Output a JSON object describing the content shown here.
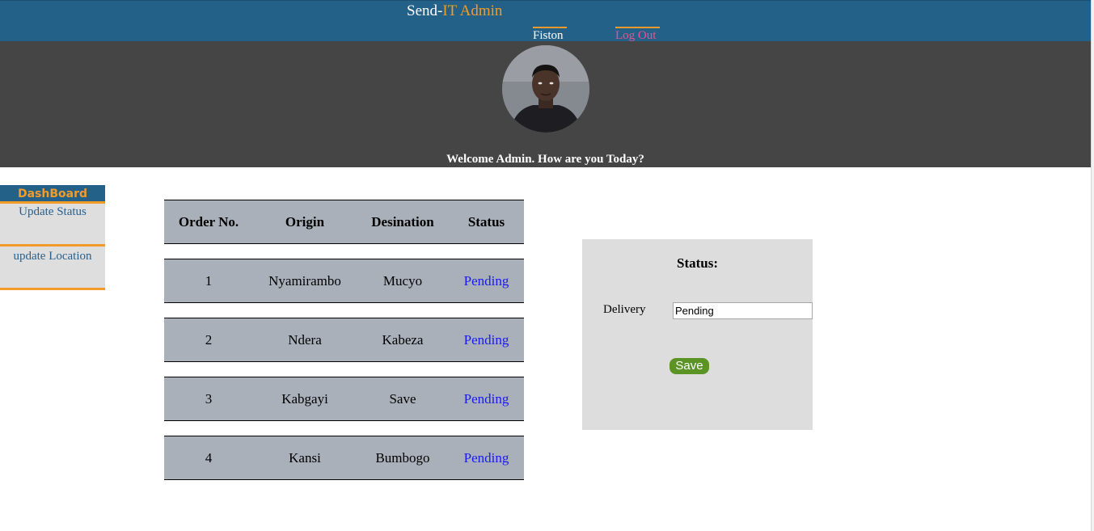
{
  "header": {
    "brand_prefix": "Send-",
    "brand_accent": "IT Admin",
    "user_link": "Fiston",
    "logout_link": "Log Out"
  },
  "hero": {
    "welcome": "Welcome Admin. How are you Today?"
  },
  "sidebar": {
    "title": "DashBoard",
    "items": [
      {
        "label": "Update Status"
      },
      {
        "label": "update Location"
      }
    ]
  },
  "orders": {
    "columns": [
      "Order No.",
      "Origin",
      "Desination",
      "Status"
    ],
    "rows": [
      {
        "order_no": "1",
        "origin": "Nyamirambo",
        "destination": "Mucyo",
        "status": "Pending"
      },
      {
        "order_no": "2",
        "origin": "Ndera",
        "destination": "Kabeza",
        "status": "Pending"
      },
      {
        "order_no": "3",
        "origin": "Kabgayi",
        "destination": "Save",
        "status": "Pending"
      },
      {
        "order_no": "4",
        "origin": "Kansi",
        "destination": "Bumbogo",
        "status": "Pending"
      }
    ]
  },
  "status_panel": {
    "title": "Status:",
    "field_label": "Delivery",
    "field_value": "Pending",
    "save_label": "Save"
  },
  "colors": {
    "header_bg": "#246189",
    "accent": "#f29b2b",
    "hero_bg": "#454545",
    "row_bg": "#a9b0ba",
    "save_bg": "#5b9324",
    "link_blue": "#1a1aee",
    "logout": "#e8528d"
  }
}
